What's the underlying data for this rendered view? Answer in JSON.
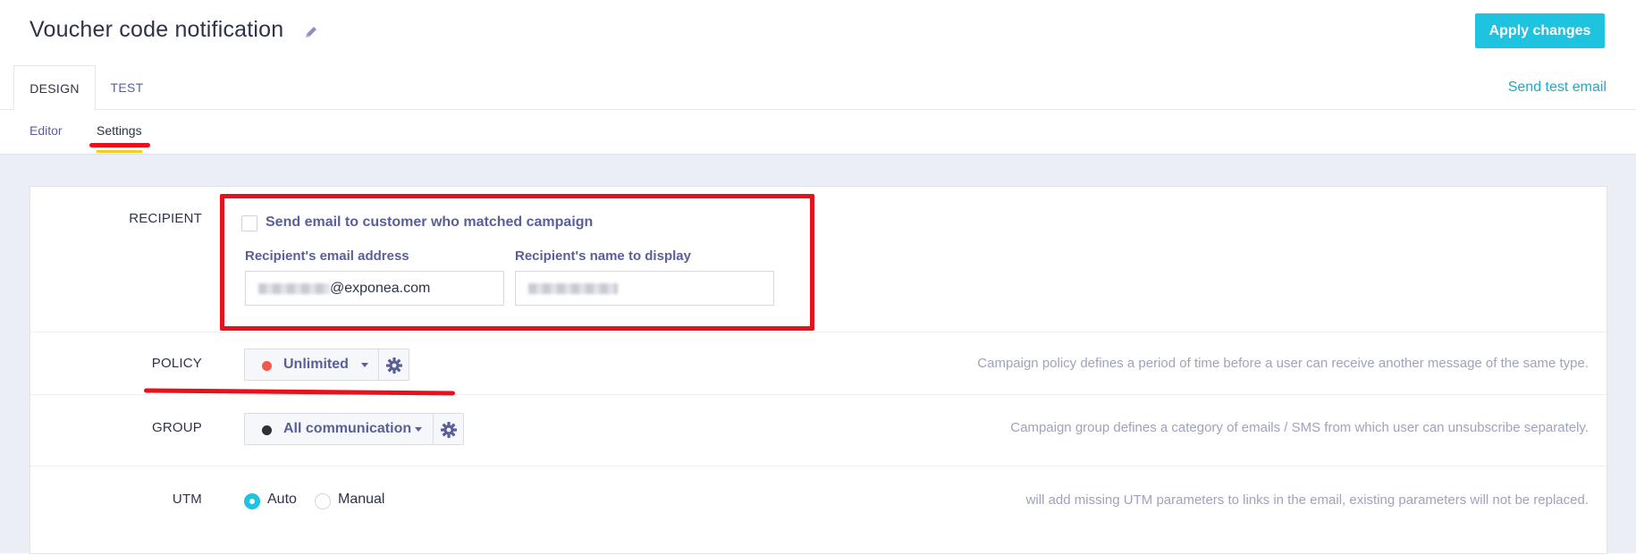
{
  "header": {
    "title": "Voucher code notification",
    "apply_label": "Apply changes",
    "send_test_label": "Send test email"
  },
  "tabs": [
    {
      "label": "DESIGN",
      "active": true
    },
    {
      "label": "TEST",
      "active": false
    }
  ],
  "subtabs": [
    {
      "label": "Editor",
      "active": false
    },
    {
      "label": "Settings",
      "active": true
    }
  ],
  "recipient": {
    "label": "RECIPIENT",
    "checkbox_label": "Send email to customer who matched campaign",
    "checked": false,
    "email_label": "Recipient's email address",
    "email_value_suffix": "@exponea.com",
    "name_label": "Recipient's name to display"
  },
  "policy": {
    "label": "POLICY",
    "value": "Unlimited",
    "dot_color": "#f15a4a",
    "hint": "Campaign policy defines a period of time before a user can receive another message of the same type."
  },
  "group": {
    "label": "GROUP",
    "value": "All communication",
    "dot_color": "#2f3035",
    "hint": "Campaign group defines a category of emails / SMS from which user can unsubscribe separately."
  },
  "utm": {
    "label": "UTM",
    "options": [
      {
        "label": "Auto",
        "selected": true
      },
      {
        "label": "Manual",
        "selected": false
      }
    ],
    "hint": "will add missing UTM parameters to links in the email, existing parameters will not be replaced."
  },
  "colors": {
    "accent": "#1ec3e0",
    "link": "#1ea9c9",
    "annotation_red": "#e8101a",
    "settings_underline": "#f2cf1e"
  }
}
